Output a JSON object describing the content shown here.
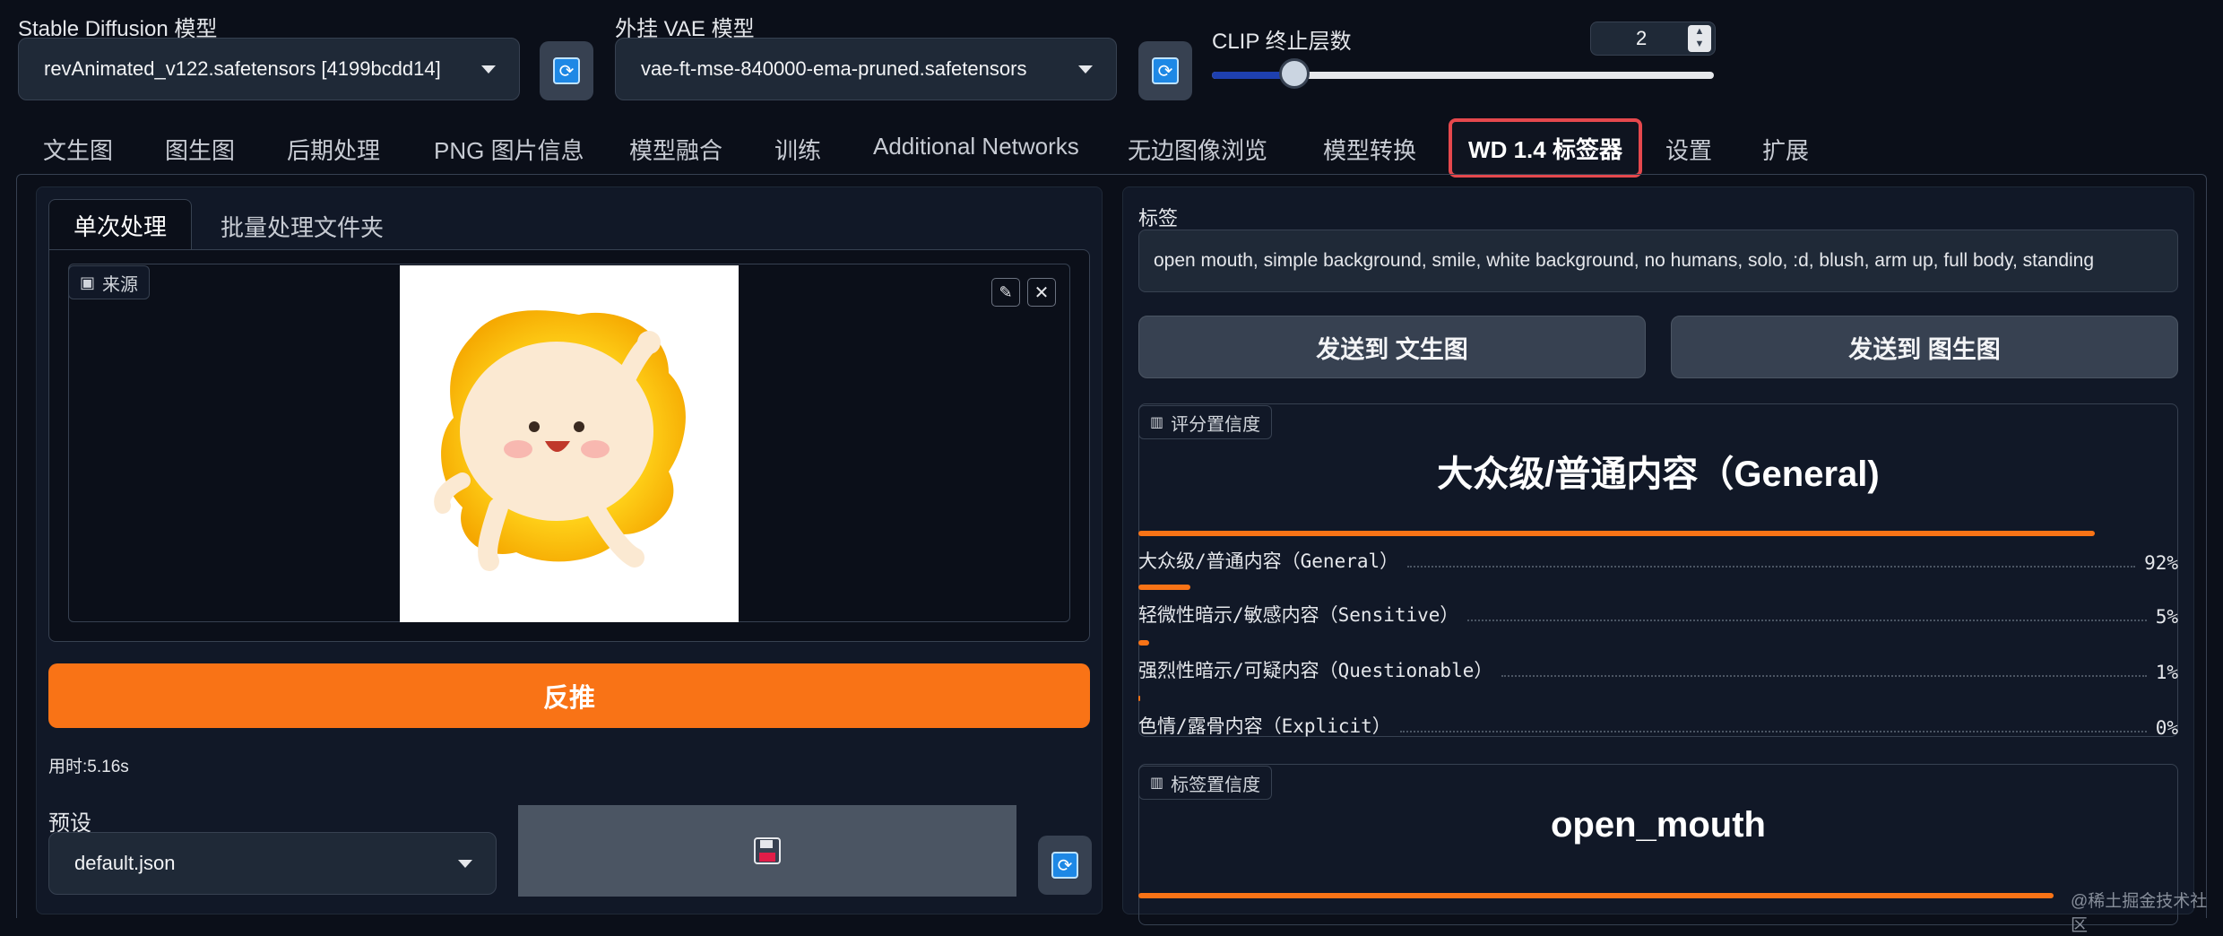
{
  "header": {
    "sd_model_label": "Stable Diffusion 模型",
    "sd_model_value": "revAnimated_v122.safetensors [4199bcdd14]",
    "vae_label": "外挂 VAE 模型",
    "vae_value": "vae-ft-mse-840000-ema-pruned.safetensors",
    "clip_label": "CLIP 终止层数",
    "clip_value": "2",
    "clip_slider": {
      "value": 2,
      "min": 1,
      "max": 12
    }
  },
  "tabs": [
    {
      "label": "文生图"
    },
    {
      "label": "图生图"
    },
    {
      "label": "后期处理"
    },
    {
      "label": "PNG 图片信息"
    },
    {
      "label": "模型融合"
    },
    {
      "label": "训练"
    },
    {
      "label": "Additional Networks"
    },
    {
      "label": "无边图像浏览"
    },
    {
      "label": "模型转换"
    },
    {
      "label": "WD 1.4 标签器"
    },
    {
      "label": "设置"
    },
    {
      "label": "扩展"
    }
  ],
  "left": {
    "subtabs": [
      {
        "label": "单次处理"
      },
      {
        "label": "批量处理文件夹"
      }
    ],
    "source_label": "来源",
    "interrogate_label": "反推",
    "time_text": "用时:5.16s",
    "preset_label": "预设",
    "preset_value": "default.json",
    "save_icon": "floppy-icon"
  },
  "right": {
    "tags_label": "标签",
    "tags_value": "open mouth, simple background, smile, white background, no humans, solo, :d, blush, arm up, full body, standing",
    "send_txt2img": "发送到 文生图",
    "send_img2img": "发送到 图生图",
    "rating_label": "评分置信度",
    "rating_top": "大众级/普通内容（General)",
    "ratings": [
      {
        "label": "大众级/普通内容（General）",
        "pct_text": "92%",
        "value": 0.92
      },
      {
        "label": "轻微性暗示/敏感内容（Sensitive）",
        "pct_text": "5%",
        "value": 0.05
      },
      {
        "label": "强烈性暗示/可疑内容（Questionable）",
        "pct_text": "1%",
        "value": 0.01
      },
      {
        "label": "色情/露骨内容（Explicit）",
        "pct_text": "0%",
        "value": 0.0
      }
    ],
    "tag_conf_label": "标签置信度",
    "tag_top": "open_mouth",
    "tag_top_value": 0.88
  },
  "watermark": "@稀土掘金技术社区",
  "colors": {
    "accent": "#f97316",
    "background": "#0b0f19",
    "highlight_border": "#e5484d"
  }
}
